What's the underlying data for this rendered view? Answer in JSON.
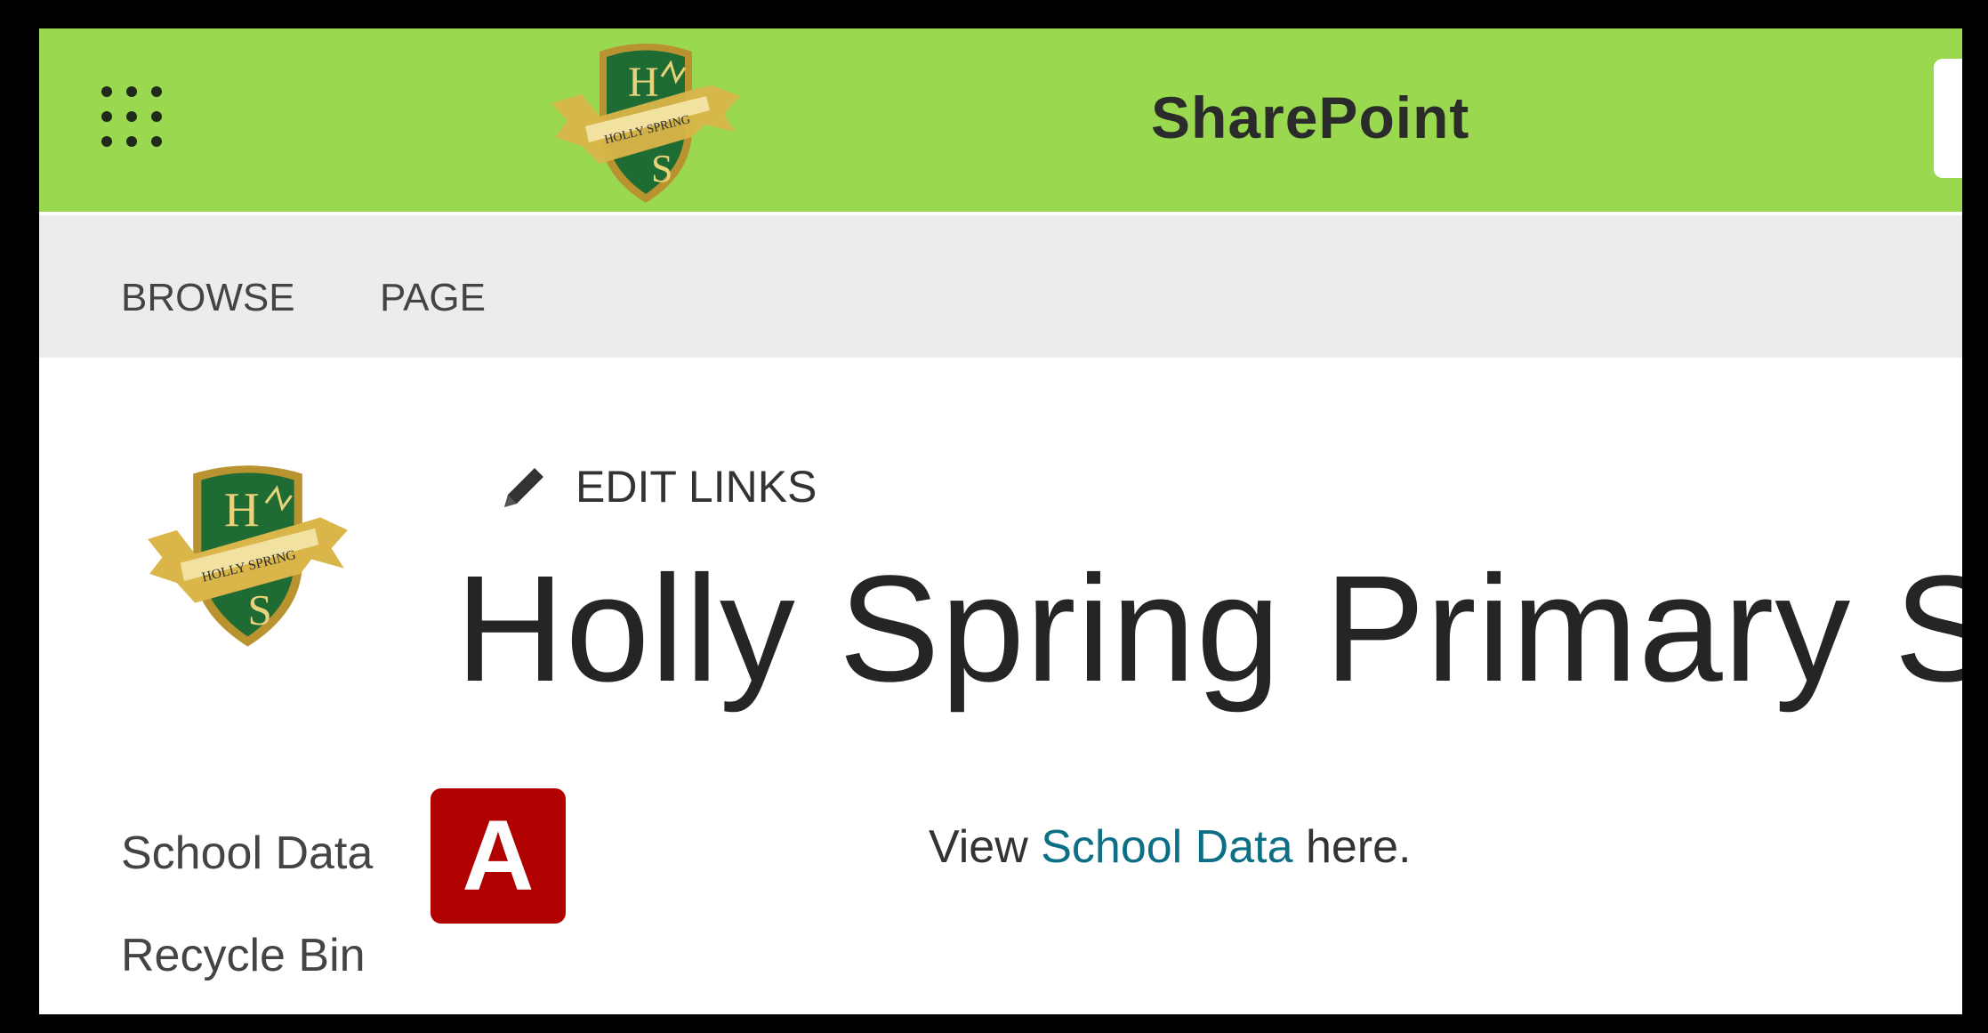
{
  "suite_bar": {
    "app_name": "SharePoint",
    "background_color": "#99d84f",
    "waffle_icon": "app-launcher-icon",
    "logo_text_top": "H",
    "logo_text_bottom": "S",
    "logo_ribbon_text": "HOLLY SPRING"
  },
  "ribbon": {
    "tabs": [
      {
        "label": "BROWSE"
      },
      {
        "label": "PAGE"
      }
    ]
  },
  "site_header": {
    "edit_links_label": "EDIT LINKS",
    "edit_icon": "pencil-icon",
    "title": "Holly Spring Primary Scho"
  },
  "quick_launch": {
    "items": [
      {
        "label": "School Data"
      },
      {
        "label": "Recycle Bin"
      }
    ]
  },
  "annotation": {
    "badge_label": "A",
    "badge_color": "#b00000"
  },
  "content": {
    "text_prefix": "View ",
    "link_text": "School Data",
    "text_suffix": " here.",
    "link_color": "#0c6f86"
  }
}
